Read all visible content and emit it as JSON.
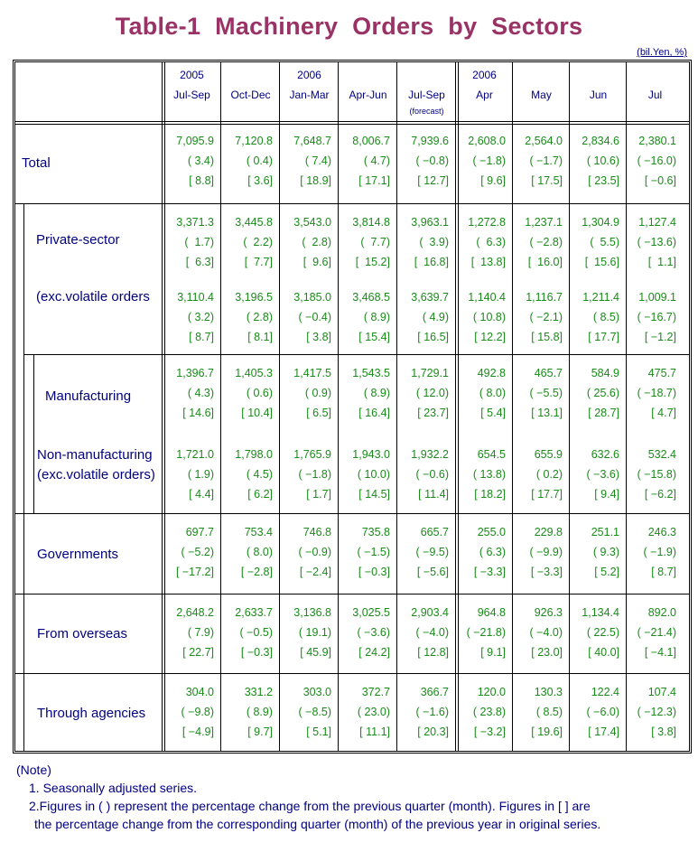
{
  "title": "Table-1  Machinery  Orders  by  Sectors",
  "unit": "(bil.Yen, %)",
  "columns": [
    {
      "year": "2005",
      "period": "Jul-Sep",
      "note": ""
    },
    {
      "year": "",
      "period": "Oct-Dec",
      "note": ""
    },
    {
      "year": "2006",
      "period": "Jan-Mar",
      "note": ""
    },
    {
      "year": "",
      "period": "Apr-Jun",
      "note": ""
    },
    {
      "year": "",
      "period": "Jul-Sep",
      "note": "(forecast)"
    },
    {
      "year": "2006",
      "period": "Apr",
      "note": ""
    },
    {
      "year": "",
      "period": "May",
      "note": ""
    },
    {
      "year": "",
      "period": "Jun",
      "note": ""
    },
    {
      "year": "",
      "period": "Jul",
      "note": ""
    }
  ],
  "rows": [
    {
      "label": "Total",
      "label2": "",
      "values": [
        "7,095.9",
        "7,120.8",
        "7,648.7",
        "8,006.7",
        "7,939.6",
        "2,608.0",
        "2,564.0",
        "2,834.6",
        "2,380.1"
      ],
      "qoq": [
        "( 3.4)",
        "( 0.4)",
        "( 7.4)",
        "( 4.7)",
        "( −0.8)",
        "( −1.8)",
        "( −1.7)",
        "( 10.6)",
        "( −16.0)"
      ],
      "yoy": [
        "[ 8.8]",
        "[ 3.6]",
        "[ 18.9]",
        "[ 17.1]",
        "[ 12.7]",
        "[ 9.6]",
        "[ 17.5]",
        "[ 23.5]",
        "[ −0.6]"
      ]
    },
    {
      "label": "Private-sector",
      "label2": "",
      "values": [
        "3,371.3",
        "3,445.8",
        "3,543.0",
        "3,814.8",
        "3,963.1",
        "1,272.8",
        "1,237.1",
        "1,304.9",
        "1,127.4"
      ],
      "qoq": [
        "(  1.7)",
        "(  2.2)",
        "(  2.8)",
        "(  7.7)",
        "(  3.9)",
        "(  6.3)",
        "( −2.8)",
        "(  5.5)",
        "( −13.6)"
      ],
      "yoy": [
        "[  6.3]",
        "[  7.7]",
        "[  9.6]",
        "[  15.2]",
        "[  16.8]",
        "[  13.8]",
        "[  16.0]",
        "[  15.6]",
        "[  1.1]"
      ]
    },
    {
      "label": "(exc.volatile orders",
      "label2": "",
      "values": [
        "3,110.4",
        "3,196.5",
        "3,185.0",
        "3,468.5",
        "3,639.7",
        "1,140.4",
        "1,116.7",
        "1,211.4",
        "1,009.1"
      ],
      "qoq": [
        "( 3.2)",
        "( 2.8)",
        "( −0.4)",
        "( 8.9)",
        "( 4.9)",
        "( 10.8)",
        "( −2.1)",
        "( 8.5)",
        "( −16.7)"
      ],
      "yoy": [
        "[ 8.7]",
        "[ 8.1]",
        "[ 3.8]",
        "[ 15.4]",
        "[ 16.5]",
        "[ 12.2]",
        "[ 15.8]",
        "[ 17.7]",
        "[ −1.2]"
      ]
    },
    {
      "label": "Manufacturing",
      "label2": "",
      "values": [
        "1,396.7",
        "1,405.3",
        "1,417.5",
        "1,543.5",
        "1,729.1",
        "492.8",
        "465.7",
        "584.9",
        "475.7"
      ],
      "qoq": [
        "( 4.3)",
        "( 0.6)",
        "( 0.9)",
        "( 8.9)",
        "( 12.0)",
        "( 8.0)",
        "( −5.5)",
        "( 25.6)",
        "( −18.7)"
      ],
      "yoy": [
        "[ 14.6]",
        "[ 10.4]",
        "[ 6.5]",
        "[ 16.4]",
        "[ 23.7]",
        "[ 5.4]",
        "[ 13.1]",
        "[ 28.7]",
        "[ 4.7]"
      ]
    },
    {
      "label": "Non-manufacturing",
      "label2": "(exc.volatile orders)",
      "values": [
        "1,721.0",
        "1,798.0",
        "1,765.9",
        "1,943.0",
        "1,932.2",
        "654.5",
        "655.9",
        "632.6",
        "532.4"
      ],
      "qoq": [
        "( 1.9)",
        "( 4.5)",
        "( −1.8)",
        "( 10.0)",
        "( −0.6)",
        "( 13.8)",
        "( 0.2)",
        "( −3.6)",
        "( −15.8)"
      ],
      "yoy": [
        "[ 4.4]",
        "[ 6.2]",
        "[ 1.7]",
        "[ 14.5]",
        "[ 11.4]",
        "[ 18.2]",
        "[ 17.7]",
        "[ 9.4]",
        "[ −6.2]"
      ]
    },
    {
      "label": "Governments",
      "label2": "",
      "values": [
        "697.7",
        "753.4",
        "746.8",
        "735.8",
        "665.7",
        "255.0",
        "229.8",
        "251.1",
        "246.3"
      ],
      "qoq": [
        "( −5.2)",
        "( 8.0)",
        "( −0.9)",
        "( −1.5)",
        "( −9.5)",
        "( 6.3)",
        "( −9.9)",
        "( 9.3)",
        "( −1.9)"
      ],
      "yoy": [
        "[ −17.2]",
        "[ −2.8]",
        "[ −2.4]",
        "[ −0.3]",
        "[ −5.6]",
        "[ −3.3]",
        "[ −3.3]",
        "[ 5.2]",
        "[ 8.7]"
      ]
    },
    {
      "label": "From overseas",
      "label2": "",
      "values": [
        "2,648.2",
        "2,633.7",
        "3,136.8",
        "3,025.5",
        "2,903.4",
        "964.8",
        "926.3",
        "1,134.4",
        "892.0"
      ],
      "qoq": [
        "( 7.9)",
        "( −0.5)",
        "( 19.1)",
        "( −3.6)",
        "( −4.0)",
        "( −21.8)",
        "( −4.0)",
        "( 22.5)",
        "( −21.4)"
      ],
      "yoy": [
        "[ 22.7]",
        "[ −0.3]",
        "[ 45.9]",
        "[ 24.2]",
        "[ 12.8]",
        "[ 9.1]",
        "[ 23.0]",
        "[ 40.0]",
        "[ −4.1]"
      ]
    },
    {
      "label": "Through agencies",
      "label2": "",
      "values": [
        "304.0",
        "331.2",
        "303.0",
        "372.7",
        "366.7",
        "120.0",
        "130.3",
        "122.4",
        "107.4"
      ],
      "qoq": [
        "( −9.8)",
        "( 8.9)",
        "( −8.5)",
        "( 23.0)",
        "( −1.6)",
        "( 23.8)",
        "( 8.5)",
        "( −6.0)",
        "( −12.3)"
      ],
      "yoy": [
        "[ −4.9]",
        "[ 9.7]",
        "[ 5.1]",
        "[ 11.1]",
        "[ 20.3]",
        "[ −3.2]",
        "[ 19.6]",
        "[ 17.4]",
        "[ 3.8]"
      ]
    }
  ],
  "notes": {
    "heading": "(Note)",
    "items": [
      "1. Seasonally adjusted series.",
      "2.Figures in ( ) represent the percentage change from the previous quarter (month). Figures in [ ] are",
      "  the percentage change from the corresponding quarter (month) of the previous year in original series."
    ]
  }
}
